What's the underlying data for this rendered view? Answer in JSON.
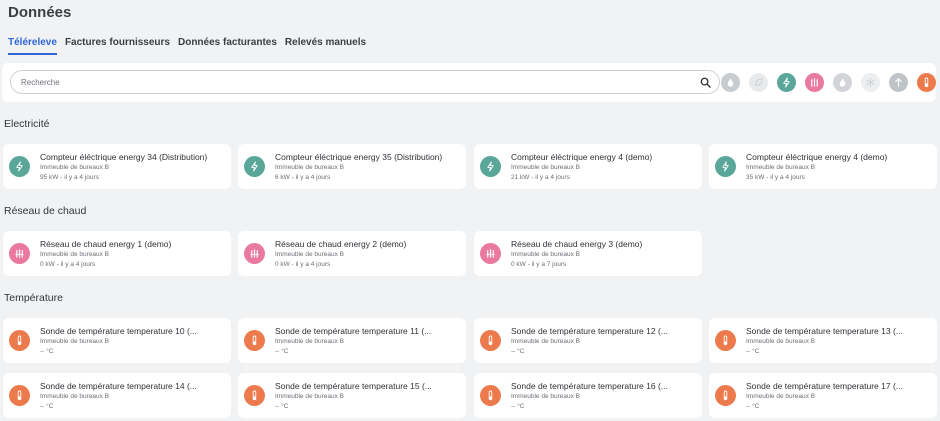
{
  "page": {
    "title": "Données"
  },
  "tabs": [
    {
      "label": "Téléreleve",
      "active": true
    },
    {
      "label": "Factures fournisseurs",
      "active": false
    },
    {
      "label": "Données facturantes",
      "active": false
    },
    {
      "label": "Relevés manuels",
      "active": false
    }
  ],
  "search": {
    "placeholder": "Recherche",
    "value": ""
  },
  "filters": [
    {
      "name": "filter-water-icon",
      "color": "#c9cccf"
    },
    {
      "name": "filter-leaf-icon",
      "color": "#e8eaec"
    },
    {
      "name": "filter-electricity-icon",
      "color": "#5aa79a"
    },
    {
      "name": "filter-heating-icon",
      "color": "#e9799f"
    },
    {
      "name": "filter-gas-icon",
      "color": "#d2d4d7"
    },
    {
      "name": "filter-cold-icon",
      "color": "#eceef0"
    },
    {
      "name": "filter-pressure-icon",
      "color": "#bfc2c6"
    },
    {
      "name": "filter-temperature-icon",
      "color": "#ec7a4c"
    }
  ],
  "colors": {
    "electricity": "#5aa79a",
    "heating": "#e9799f",
    "temperature": "#ec7a4c",
    "accent": "#2f66d6"
  },
  "sections": [
    {
      "title": "Electricité",
      "icon": "electricity-icon",
      "color": "#5aa79a",
      "items": [
        {
          "name": "Compteur éléctrique energy 34 (Distribution)",
          "building": "Immeuble de bureaux B",
          "value": "95 kW - il y a 4 jours"
        },
        {
          "name": "Compteur éléctrique energy 35 (Distribution)",
          "building": "Immeuble de bureaux B",
          "value": "6 kW - il y a 4 jours"
        },
        {
          "name": "Compteur éléctrique energy 4 (demo)",
          "building": "Immeuble de bureaux B",
          "value": "21 kW - il y a 4 jours"
        },
        {
          "name": "Compteur éléctrique energy 4 (demo)",
          "building": "Immeuble de bureaux B",
          "value": "35 kW - il y a 4 jours"
        }
      ]
    },
    {
      "title": "Réseau de chaud",
      "icon": "heating-icon",
      "color": "#e9799f",
      "items": [
        {
          "name": "Réseau de chaud energy 1 (demo)",
          "building": "Immeuble de bureaux B",
          "value": "0 kW - il y a 4 jours"
        },
        {
          "name": "Réseau de chaud energy 2 (demo)",
          "building": "Immeuble de bureaux B",
          "value": "0 kW - il y a 4 jours"
        },
        {
          "name": "Réseau de chaud energy 3 (demo)",
          "building": "Immeuble de bureaux B",
          "value": "0 kW - il y a 7 jours"
        }
      ]
    },
    {
      "title": "Température",
      "icon": "thermometer-icon",
      "color": "#ec7a4c",
      "items": [
        {
          "name": "Sonde de température temperature 10 (...",
          "building": "Immeuble de bureaux B",
          "value": "-- °C"
        },
        {
          "name": "Sonde de température temperature 11 (...",
          "building": "Immeuble de bureaux B",
          "value": "-- °C"
        },
        {
          "name": "Sonde de température temperature 12 (...",
          "building": "Immeuble de bureaux B",
          "value": "-- °C"
        },
        {
          "name": "Sonde de température temperature 13 (...",
          "building": "Immeuble de bureaux B",
          "value": "-- °C"
        },
        {
          "name": "Sonde de température temperature 14 (...",
          "building": "Immeuble de bureaux B",
          "value": "-- °C"
        },
        {
          "name": "Sonde de température temperature 15 (...",
          "building": "Immeuble de bureaux B",
          "value": "-- °C"
        },
        {
          "name": "Sonde de température temperature 16 (...",
          "building": "Immeuble de bureaux B",
          "value": "-- °C"
        },
        {
          "name": "Sonde de température temperature 17 (...",
          "building": "Immeuble de bureaux B",
          "value": "-- °C"
        }
      ]
    }
  ]
}
